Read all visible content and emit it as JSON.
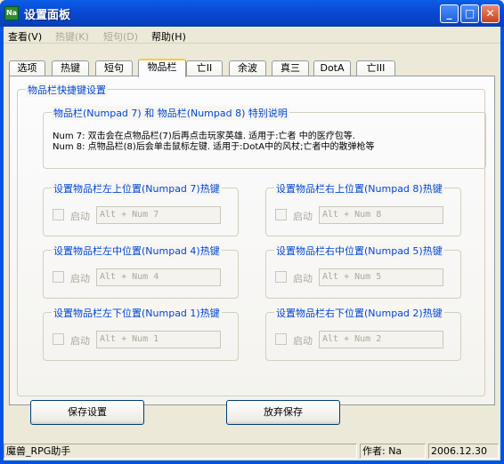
{
  "window": {
    "title": "设置面板",
    "app_icon_text": "Na"
  },
  "menu": [
    {
      "label": "查看(V)",
      "enabled": true
    },
    {
      "label": "热键(K)",
      "enabled": false
    },
    {
      "label": "短句(D)",
      "enabled": false
    },
    {
      "label": "帮助(H)",
      "enabled": true
    }
  ],
  "tabs": [
    {
      "label": "选项",
      "active": false
    },
    {
      "label": "热键",
      "active": false
    },
    {
      "label": "短句",
      "active": false
    },
    {
      "label": "物品栏",
      "active": true
    },
    {
      "label": "亡II",
      "active": false
    },
    {
      "label": "余波",
      "active": false
    },
    {
      "label": "真三",
      "active": false
    },
    {
      "label": "DotA",
      "active": false
    },
    {
      "label": "亡III",
      "active": false
    }
  ],
  "panel": {
    "group_title": "物品栏快捷键设置",
    "note": {
      "title": "物品栏(Numpad 7) 和 物品栏(Numpad 8) 特别说明",
      "line1": "Num 7: 双击会在点物品栏(7)后再点击玩家英雄. 适用于:亡者 中的医疗包等.",
      "line2": "Num 8: 点物品栏(8)后会单击鼠标左键. 适用于:DotA中的风杖;亡者中的散弹枪等"
    },
    "hotkeys": [
      {
        "title": "设置物品栏左上位置(Numpad 7)热键",
        "enable_label": "启动",
        "value": "Alt + Num 7",
        "checked": false
      },
      {
        "title": "设置物品栏右上位置(Numpad 8)热键",
        "enable_label": "启动",
        "value": "Alt + Num 8",
        "checked": false
      },
      {
        "title": "设置物品栏左中位置(Numpad 4)热键",
        "enable_label": "启动",
        "value": "Alt + Num 4",
        "checked": false
      },
      {
        "title": "设置物品栏右中位置(Numpad 5)热键",
        "enable_label": "启动",
        "value": "Alt + Num 5",
        "checked": false
      },
      {
        "title": "设置物品栏左下位置(Numpad 1)热键",
        "enable_label": "启动",
        "value": "Alt + Num 1",
        "checked": false
      },
      {
        "title": "设置物品栏右下位置(Numpad 2)热键",
        "enable_label": "启动",
        "value": "Alt + Num 2",
        "checked": false
      }
    ]
  },
  "buttons": {
    "save": "保存设置",
    "discard": "放弃保存"
  },
  "status": {
    "app_name": "魔兽_RPG助手",
    "author": "作者: Na",
    "date": "2006.12.30"
  },
  "colors": {
    "title_bar": "#0054E3",
    "group_title": "#0046D5",
    "disabled_text": "#ACA899",
    "active_tab_accent": "#FFC83C"
  }
}
